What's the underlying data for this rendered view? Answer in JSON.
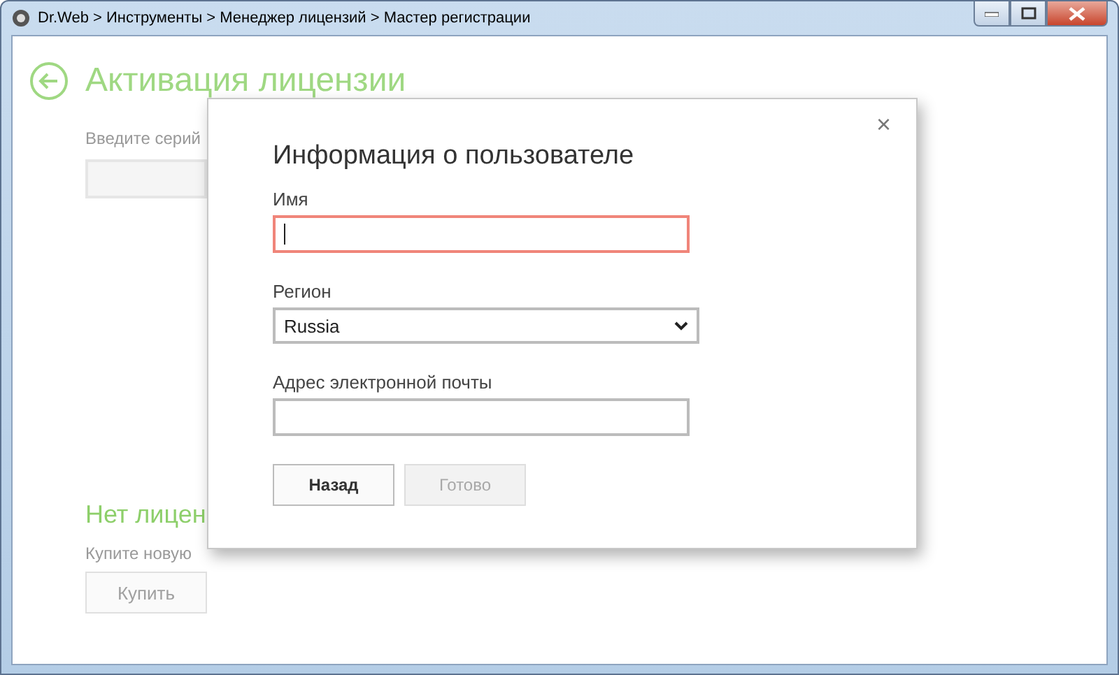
{
  "window": {
    "title": "Dr.Web > Инструменты > Менеджер лицензий > Мастер регистрации"
  },
  "page": {
    "title": "Активация лицензии",
    "serial_label": "Введите серий",
    "no_license_title": "Нет лицен",
    "no_license_text": "Купите новую",
    "buy_button": "Купить"
  },
  "dialog": {
    "title": "Информация о пользователе",
    "close": "×",
    "fields": [
      {
        "kind": "text",
        "label": "Имя",
        "focused": true
      },
      {
        "kind": "select",
        "label": "Регион",
        "value": "Russia",
        "focused": false
      },
      {
        "kind": "text",
        "label": "Адрес электронной почты",
        "focused": false
      }
    ],
    "buttons": [
      {
        "label": "Назад",
        "disabled": false
      },
      {
        "label": "Готово",
        "disabled": true
      }
    ]
  }
}
